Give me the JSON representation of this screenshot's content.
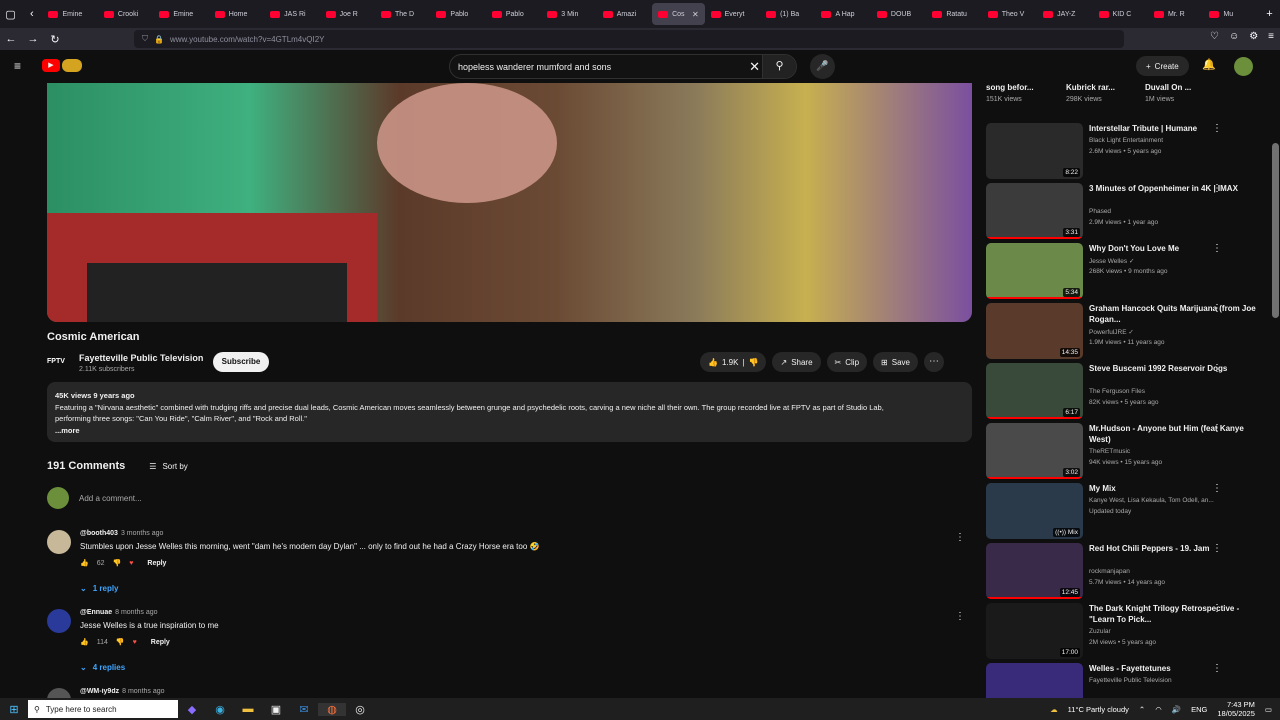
{
  "browser": {
    "tabs": [
      {
        "label": "Emine"
      },
      {
        "label": "Crooki"
      },
      {
        "label": "Emine"
      },
      {
        "label": "Home"
      },
      {
        "label": "JAS Ri"
      },
      {
        "label": "Joe R"
      },
      {
        "label": "The D"
      },
      {
        "label": "Pablo"
      },
      {
        "label": "Pablo"
      },
      {
        "label": "3 Min"
      },
      {
        "label": "Amazi"
      },
      {
        "label": "Cos"
      },
      {
        "label": "Everyt"
      },
      {
        "label": "(1) Ba"
      },
      {
        "label": "A Hap"
      },
      {
        "label": "DOUB"
      },
      {
        "label": "Ratatu"
      },
      {
        "label": "Theo V"
      },
      {
        "label": "JAY-Z"
      },
      {
        "label": "KID C"
      },
      {
        "label": "Mr. R"
      },
      {
        "label": "Mu"
      }
    ],
    "active_tab_index": 11,
    "url": "www.youtube.com/watch?v=4GTLm4vQI2Y",
    "nav_icons": [
      "back-icon",
      "forward-icon",
      "reload-icon"
    ]
  },
  "header": {
    "search_query": "hopeless wanderer mumford and sons",
    "create_label": "Create"
  },
  "video": {
    "title": "Cosmic American",
    "channel_logo": "FPTV",
    "channel_name": "Fayetteville Public Television",
    "subscribers": "2.11K subscribers",
    "subscribe_label": "Subscribe",
    "likes": "1.9K",
    "share_label": "Share",
    "clip_label": "Clip",
    "save_label": "Save",
    "views_age": "45K views  9 years ago",
    "description_line1": "Featuring a \"Nirvana aesthetic\" combined with trudging riffs and precise dual leads, Cosmic American moves seamlessly between grunge and psychedelic roots, carving a new niche all their own. The group recorded live at FPTV as part of Studio Lab,",
    "description_line2": "performing three songs: \"Can You Ride\", \"Calm River\", and \"Rock and Roll.\"",
    "more_label": "...more"
  },
  "comments": {
    "count": "191 Comments",
    "sort_label": "Sort by",
    "add_placeholder": "Add a comment...",
    "items": [
      {
        "handle": "@booth403",
        "age": "3 months ago",
        "text": "Stumbles upon Jesse Welles this morning, went \"dam he's modern day Dylan\" ... only to find out he had a Crazy Horse era too 🤣",
        "likes": "62",
        "reply_label": "Reply",
        "replies_label": "1 reply"
      },
      {
        "handle": "@Ennuae",
        "age": "8 months ago",
        "text": "Jesse Welles is a true inspiration to me",
        "likes": "114",
        "reply_label": "Reply",
        "replies_label": "4 replies"
      },
      {
        "handle": "@WM-iy9dz",
        "age": "8 months ago"
      }
    ]
  },
  "sidebar": {
    "top_partial": [
      {
        "title": "song befor...",
        "views": "151K views"
      },
      {
        "title": "Kubrick rar...",
        "views": "298K views"
      },
      {
        "title": "Duvall On ...",
        "views": "1M views"
      }
    ],
    "items": [
      {
        "title": "Interstellar Tribute | Humane",
        "channel": "Black Light Entertainment",
        "meta": "2.6M views • 5 years ago",
        "duration": "8:22",
        "thumb_color": "#2a2a2a",
        "progress": 0.0
      },
      {
        "title": "3 Minutes of Oppenheimer in 4K | IMAX",
        "channel": "Phased",
        "meta": "2.9M views • 1 year ago",
        "duration": "3:31",
        "thumb_color": "#3b3b3b",
        "progress": 1.0
      },
      {
        "title": "Why Don't You Love Me",
        "channel": "Jesse Welles ✓",
        "meta": "268K views • 9 months ago",
        "duration": "5:34",
        "thumb_color": "#6b8a4a",
        "progress": 1.0
      },
      {
        "title": "Graham Hancock Quits Marijuana (from Joe Rogan...",
        "channel": "PowerfulJRE ✓",
        "meta": "1.9M views • 11 years ago",
        "duration": "14:35",
        "thumb_color": "#5a3a2a",
        "progress": 0.0
      },
      {
        "title": "Steve Buscemi 1992 Reservoir Dogs",
        "channel": "The Ferguson Files",
        "meta": "82K views • 5 years ago",
        "duration": "6:17",
        "thumb_color": "#3a4a3a",
        "progress": 1.0
      },
      {
        "title": "Mr.Hudson - Anyone but Him (feat Kanye West)",
        "channel": "TheRETmusic",
        "meta": "94K views • 15 years ago",
        "duration": "3:02",
        "thumb_color": "#4a4a4a",
        "progress": 1.0
      },
      {
        "title": "My Mix",
        "channel": "Kanye West, Lisa Kekaula, Tom Odell, an...",
        "meta": "Updated today",
        "duration": "((•)) Mix",
        "thumb_color": "#2a3a4a",
        "progress": 0.0
      },
      {
        "title": "Red Hot Chili Peppers - 19. Jam",
        "channel": "rockmanjapan",
        "meta": "5.7M views • 14 years ago",
        "duration": "12:45",
        "thumb_color": "#3a2a4a",
        "progress": 1.0
      },
      {
        "title": "The Dark Knight Trilogy Retrospective - \"Learn To Pick...",
        "channel": "Zuzular",
        "meta": "2M views • 5 years ago",
        "duration": "17:00",
        "thumb_color": "#1a1a1a",
        "progress": 0.0
      },
      {
        "title": "Welles - Fayettetunes",
        "channel": "Fayetteville Public Television",
        "meta": "",
        "duration": "",
        "thumb_color": "#3a2a7a",
        "progress": 0.0
      }
    ]
  },
  "taskbar": {
    "search_placeholder": "Type here to search",
    "weather": "11°C  Partly cloudy",
    "lang": "ENG",
    "time": "7:43 PM",
    "date": "18/05/2025"
  },
  "colors": {
    "accent": "#ff0000",
    "link": "#3ea6ff",
    "bg": "#0f0f0f"
  }
}
